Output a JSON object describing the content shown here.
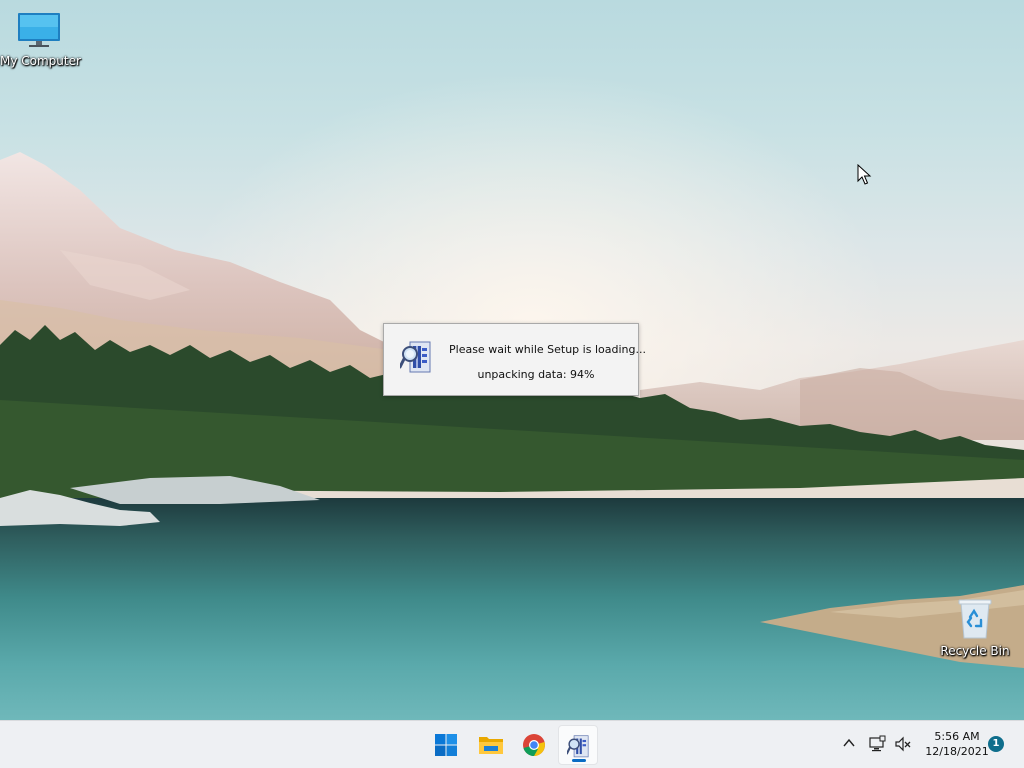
{
  "desktop": {
    "icons": [
      {
        "label": "My Computer",
        "icon": "monitor-icon"
      },
      {
        "label": "Recycle Bin",
        "icon": "recycle-bin-icon"
      }
    ]
  },
  "dialog": {
    "message": "Please wait while Setup is loading...",
    "status": "unpacking data: 94%",
    "progress_percent": 94,
    "icon": "setup-installer-icon"
  },
  "taskbar": {
    "apps": [
      {
        "name": "Start",
        "icon": "windows-start-icon"
      },
      {
        "name": "File Explorer",
        "icon": "file-explorer-icon"
      },
      {
        "name": "Google Chrome",
        "icon": "chrome-icon"
      },
      {
        "name": "Setup",
        "icon": "setup-installer-icon",
        "active": true
      }
    ],
    "tray": {
      "icons": [
        "chevron-up-icon",
        "network-icon",
        "volume-muted-icon"
      ],
      "time": "5:56 AM",
      "date": "12/18/2021",
      "notification_count": "1"
    },
    "accent_color": "#0a6cc4"
  }
}
